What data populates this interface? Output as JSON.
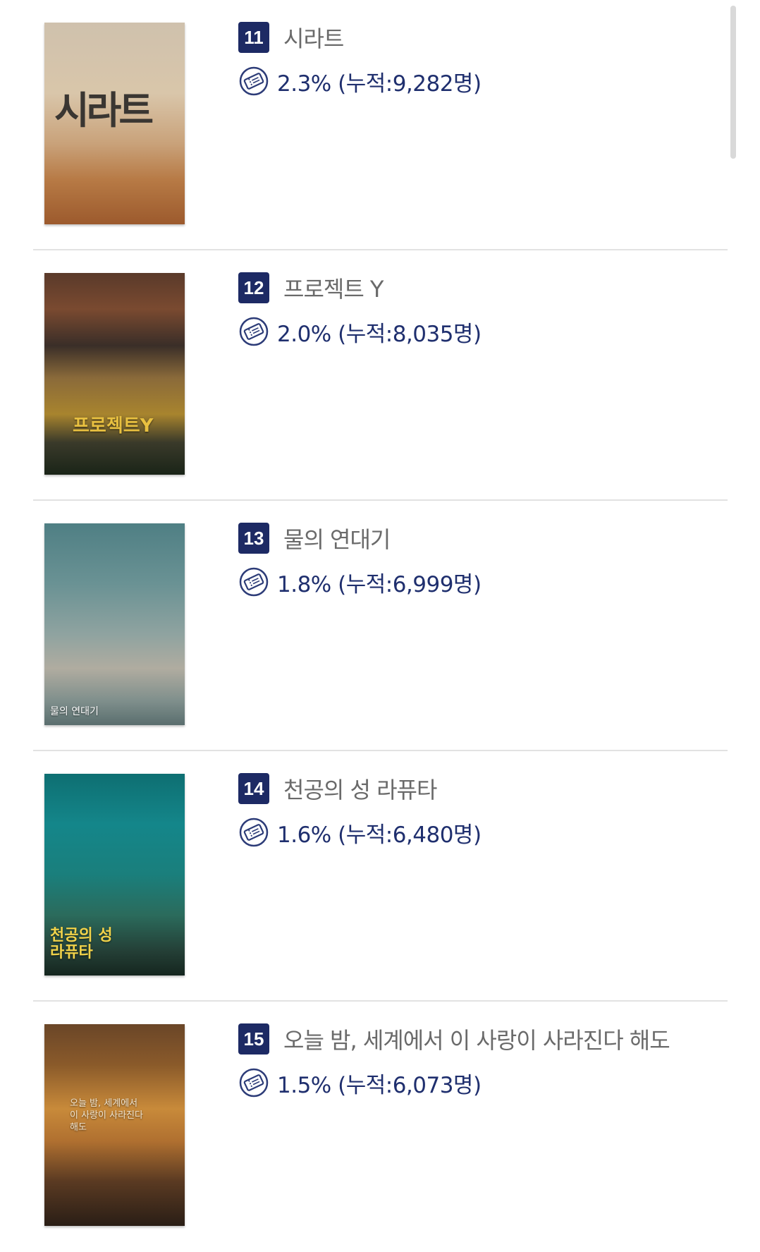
{
  "movies": [
    {
      "rank": "11",
      "title": "시라트",
      "stat": "2.3% (누적:9,282명)",
      "poster": {
        "text": "시라트",
        "bg": "linear-gradient(180deg,#cfc1ad 0%,#d9c6aa 35%,#c9a27a 60%,#b77a45 78%,#9c5a2d 100%)",
        "text_color": "#3a3632",
        "icon": "movie-poster-image"
      }
    },
    {
      "rank": "12",
      "title": "프로젝트 Y",
      "stat": "2.0% (누적:8,035명)",
      "poster": {
        "text": "프로젝트Y",
        "bg": "linear-gradient(180deg,#5a3a2a 0%,#7a4a30 18%,#3a2e28 36%,#8a6a3a 52%,#a8842e 70%,#3a3a2a 84%,#1a2418 100%)",
        "text_color": "#e8c040",
        "icon": "movie-poster-image"
      }
    },
    {
      "rank": "13",
      "title": "물의 연대기",
      "stat": "1.8% (누적:6,999명)",
      "poster": {
        "text": "물의 연대기",
        "bg": "linear-gradient(180deg,#4f7f84 0%,#6a9294 30%,#8fa3a0 55%,#b0aca0 72%,#7f8f8c 88%,#5a6e6e 100%)",
        "text_color": "#ffffff",
        "icon": "movie-poster-image"
      }
    },
    {
      "rank": "14",
      "title": "천공의 성 라퓨타",
      "stat": "1.6% (누적:6,480명)",
      "poster": {
        "text": "천공의 성 라퓨타",
        "bg": "linear-gradient(180deg,#0e6f72 0%,#14868a 25%,#1a7f7c 50%,#2b6b5c 70%,#243f36 88%,#15261f 100%)",
        "text_color": "#f0d24a",
        "icon": "movie-poster-image"
      }
    },
    {
      "rank": "15",
      "title": "오늘 밤, 세계에서 이 사랑이 사라진다 해도",
      "stat": "1.5% (누적:6,073명)",
      "poster": {
        "text": "오늘 밤, 세계에서 이 사랑이 사라진다 해도",
        "bg": "linear-gradient(180deg,#6a4628 0%,#8a5a2a 20%,#c88a3a 42%,#b07030 58%,#5a3a22 78%,#2a1e16 100%)",
        "text_color": "#f3e6d0",
        "icon": "movie-poster-image"
      }
    }
  ],
  "icons": {
    "stat": "ticket-icon"
  },
  "colors": {
    "rank_bg": "#1d2a64",
    "stat_text": "#1f2f6e",
    "title_text": "#6a6a6a",
    "divider": "#e2e2e2"
  }
}
